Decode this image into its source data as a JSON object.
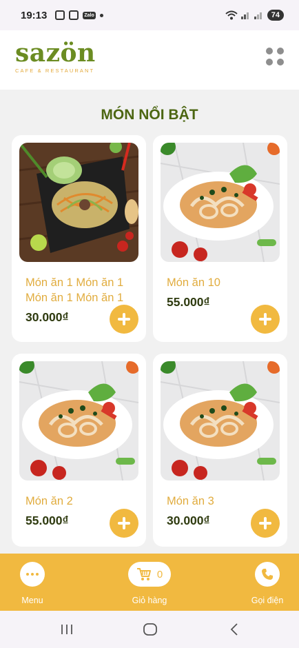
{
  "status_bar": {
    "time": "19:13",
    "zalo": "Zalo",
    "battery": "74"
  },
  "header": {
    "logo_text": "sazön",
    "logo_tagline": "CAFE & RESTAURANT"
  },
  "section_title": "MÓN NỔI BẬT",
  "products": [
    {
      "name": "Món ăn 1 Món ăn 1 Món ăn 1 Món ăn 1",
      "price": "30.000₫",
      "image": "papaya-salad"
    },
    {
      "name": "Món ăn 10",
      "price": "55.000₫",
      "image": "squid-dish"
    },
    {
      "name": "Món ăn 2",
      "price": "55.000₫",
      "image": "squid-dish"
    },
    {
      "name": "Món ăn 3",
      "price": "30.000₫",
      "image": "squid-dish"
    }
  ],
  "bottom_nav": {
    "menu_label": "Menu",
    "cart_label": "Giỏ hàng",
    "cart_count": "0",
    "call_label": "Gọi điện"
  },
  "colors": {
    "accent": "#f1b940",
    "brand_green": "#6b8c22",
    "title_green": "#4c6612",
    "name_gold": "#e1ac3e"
  }
}
